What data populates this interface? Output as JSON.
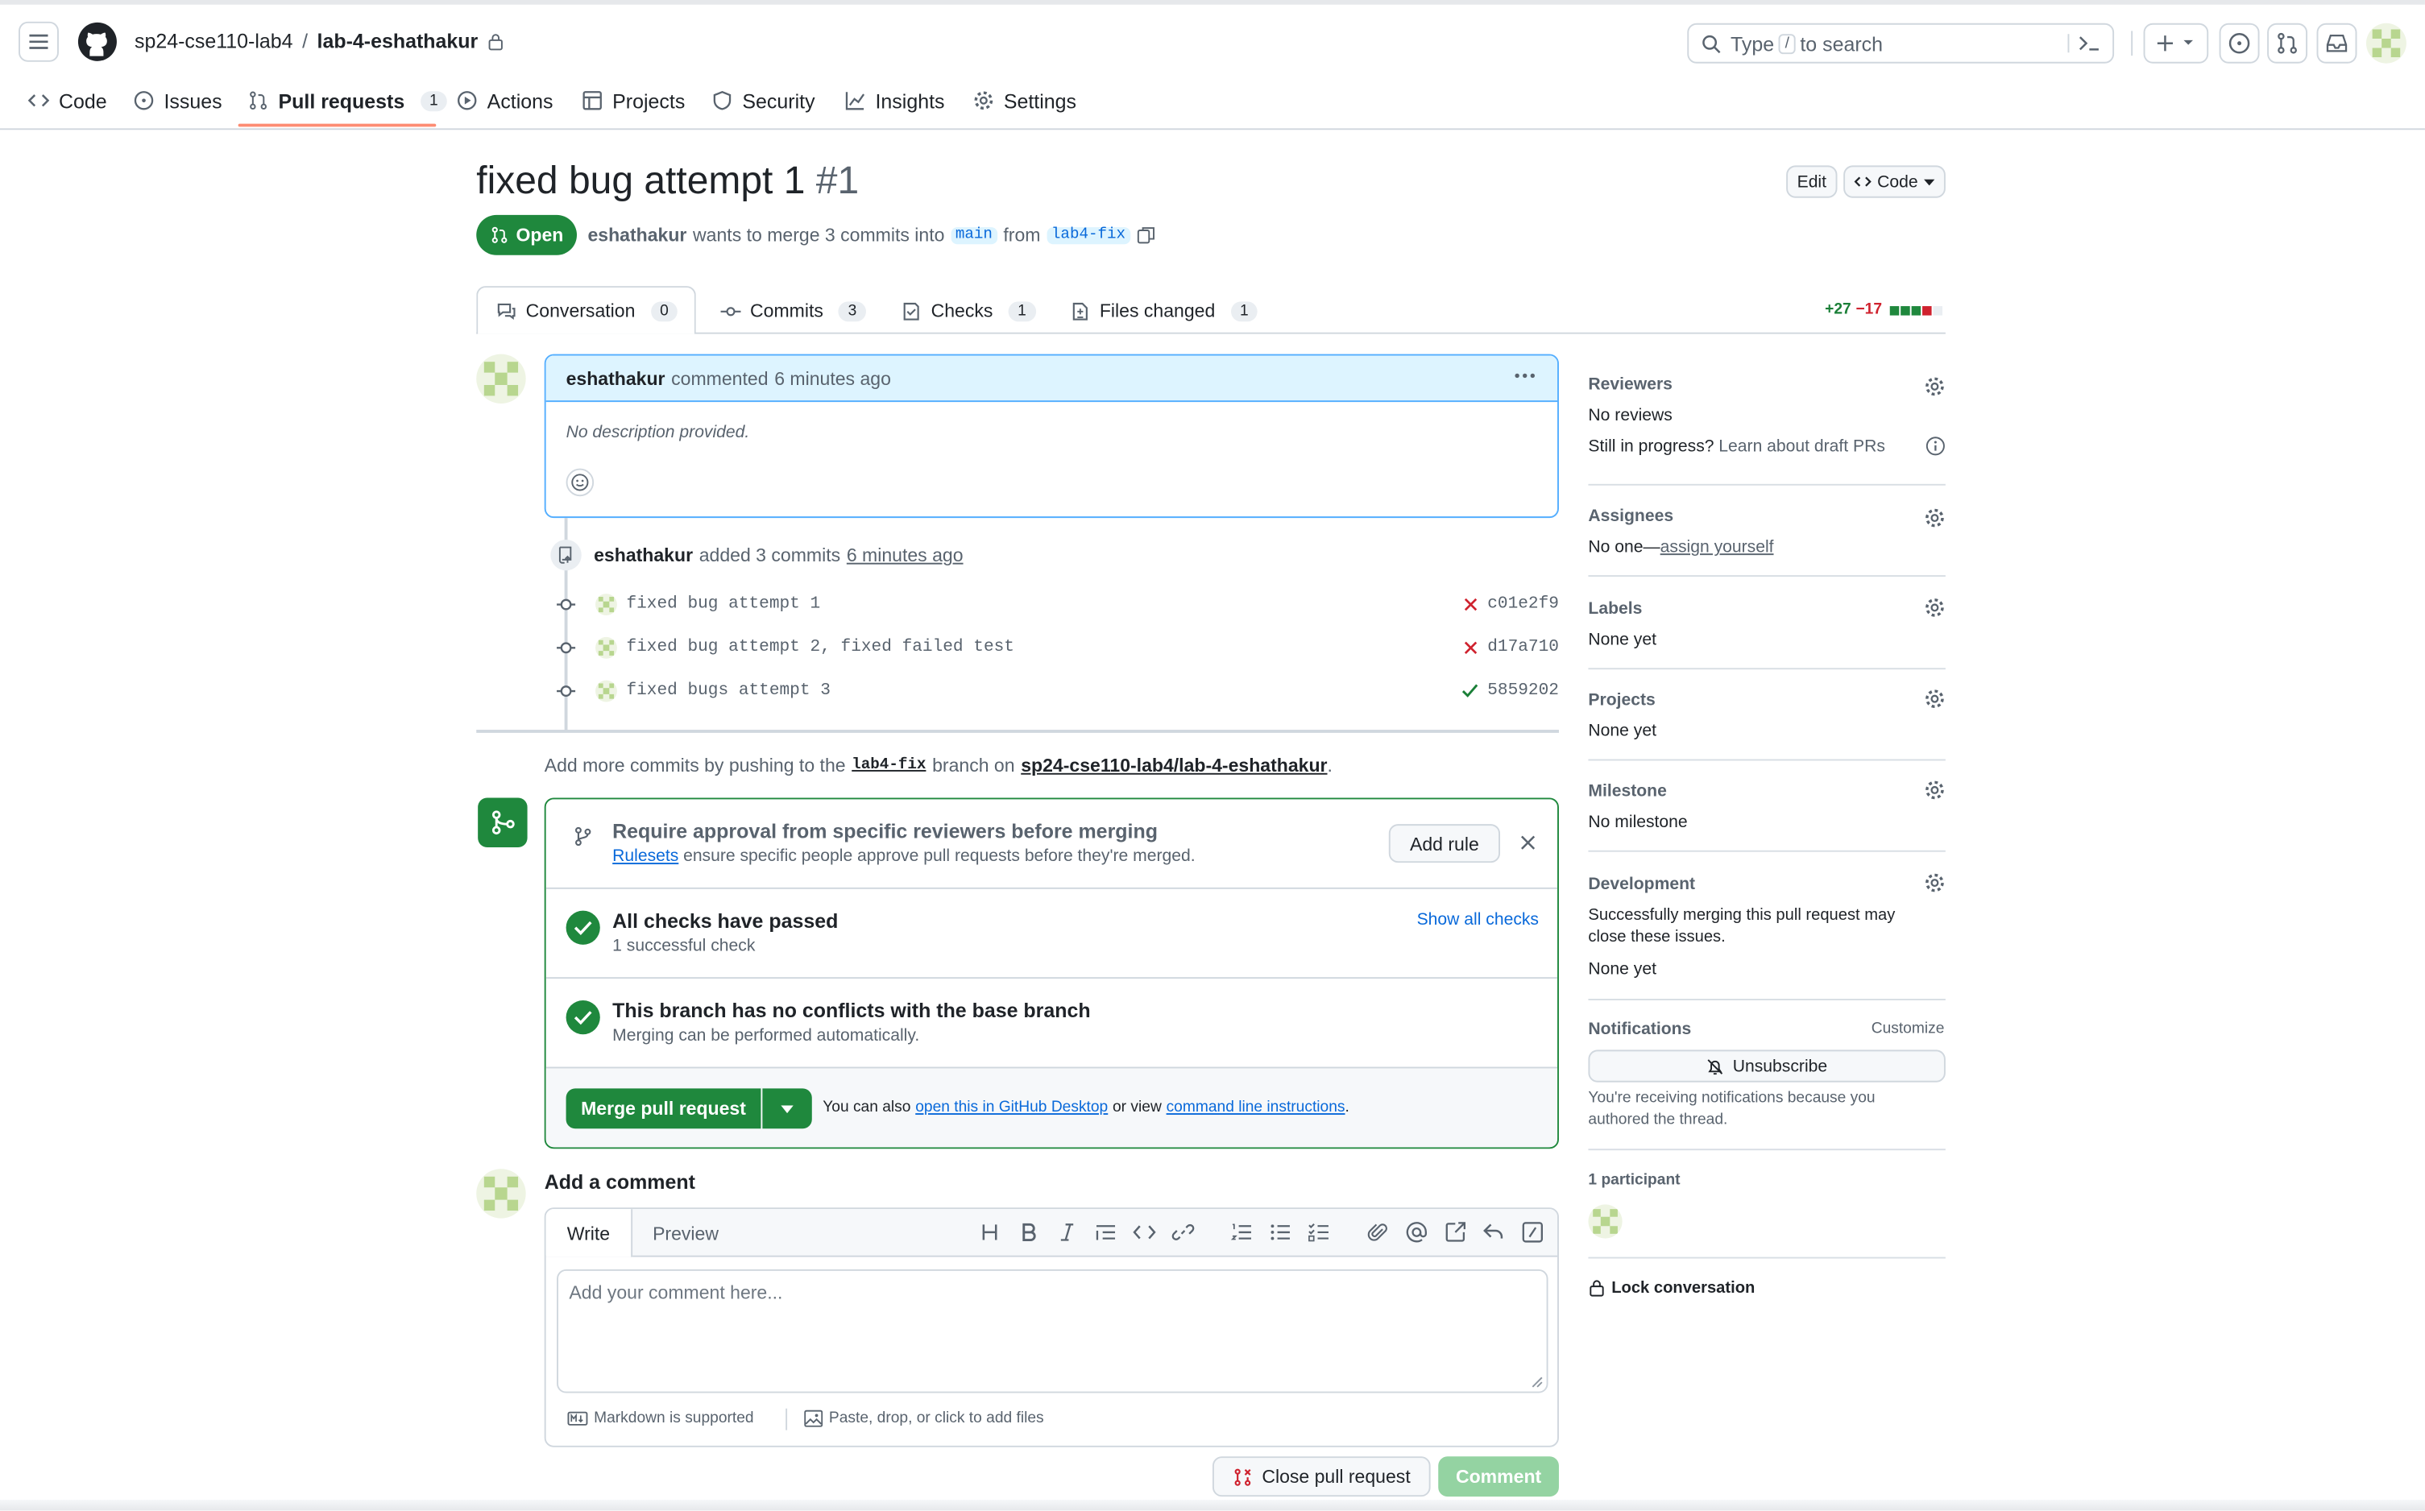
{
  "header": {
    "owner": "sp24-cse110-lab4",
    "separator": "/",
    "repo": "lab-4-eshathakur",
    "search_placeholder": "Type / to search",
    "search_pre": "Type",
    "search_key": "/",
    "search_post": "to search"
  },
  "nav": [
    {
      "label": "Code"
    },
    {
      "label": "Issues"
    },
    {
      "label": "Pull requests",
      "count": "1"
    },
    {
      "label": "Actions"
    },
    {
      "label": "Projects"
    },
    {
      "label": "Security"
    },
    {
      "label": "Insights"
    },
    {
      "label": "Settings"
    }
  ],
  "pr": {
    "title": "fixed bug attempt 1",
    "number": "#1",
    "state": "Open",
    "author": "eshathakur",
    "merge_text": "wants to merge 3 commits into",
    "base": "main",
    "from_text": "from",
    "head": "lab4-fix",
    "edit_label": "Edit",
    "code_label": "Code"
  },
  "tabs": [
    {
      "label": "Conversation",
      "count": "0"
    },
    {
      "label": "Commits",
      "count": "3"
    },
    {
      "label": "Checks",
      "count": "1"
    },
    {
      "label": "Files changed",
      "count": "1"
    }
  ],
  "diffstat": {
    "added": "+27",
    "removed": "−17"
  },
  "comment": {
    "author": "eshathakur",
    "action": "commented",
    "time": "6 minutes ago",
    "body": "No description provided."
  },
  "commits_event": {
    "author": "eshathakur",
    "action": "added 3 commits",
    "time": "6 minutes ago"
  },
  "commits": [
    {
      "message": "fixed bug attempt 1",
      "sha": "c01e2f9",
      "status": "fail"
    },
    {
      "message": "fixed bug attempt 2, fixed failed test",
      "sha": "d17a710",
      "status": "fail"
    },
    {
      "message": "fixed bugs attempt 3",
      "sha": "5859202",
      "status": "pass"
    }
  ],
  "push_hint": {
    "pre": "Add more commits by pushing to the",
    "branch": "lab4-fix",
    "mid": "branch on",
    "repo": "sp24-cse110-lab4/lab-4-eshathakur",
    "post": "."
  },
  "merge_box": {
    "rule_title": "Require approval from specific reviewers before merging",
    "rule_link": "Rulesets",
    "rule_text": "ensure specific people approve pull requests before they're merged.",
    "add_rule": "Add rule",
    "checks_title": "All checks have passed",
    "checks_sub": "1 successful check",
    "show_checks": "Show all checks",
    "conflicts_title": "This branch has no conflicts with the base branch",
    "conflicts_sub": "Merging can be performed automatically.",
    "merge_button": "Merge pull request",
    "also_pre": "You can also",
    "desktop_link": "open this in GitHub Desktop",
    "also_mid": "or view",
    "cli_link": "command line instructions",
    "also_post": "."
  },
  "add_comment": {
    "title": "Add a comment",
    "write_tab": "Write",
    "preview_tab": "Preview",
    "placeholder": "Add your comment here...",
    "markdown": "Markdown is supported",
    "attach": "Paste, drop, or click to add files",
    "close_button": "Close pull request",
    "comment_button": "Comment"
  },
  "sidebar": {
    "reviewers": {
      "title": "Reviewers",
      "value": "No reviews",
      "draft_pre": "Still in progress?",
      "draft_link": "Learn about draft PRs"
    },
    "assignees": {
      "title": "Assignees",
      "value": "No one—",
      "link": "assign yourself"
    },
    "labels": {
      "title": "Labels",
      "value": "None yet"
    },
    "projects": {
      "title": "Projects",
      "value": "None yet"
    },
    "milestone": {
      "title": "Milestone",
      "value": "No milestone"
    },
    "development": {
      "title": "Development",
      "text": "Successfully merging this pull request may close these issues.",
      "value": "None yet"
    },
    "notifications": {
      "title": "Notifications",
      "customize": "Customize",
      "button": "Unsubscribe",
      "text": "You're receiving notifications because you authored the thread."
    },
    "participants": {
      "title": "1 participant"
    },
    "lock": "Lock conversation"
  },
  "colors": {
    "green": "#1f883d",
    "blue": "#0969da",
    "red": "#cf222e",
    "border": "#d0d7de",
    "muted": "#59636e"
  }
}
